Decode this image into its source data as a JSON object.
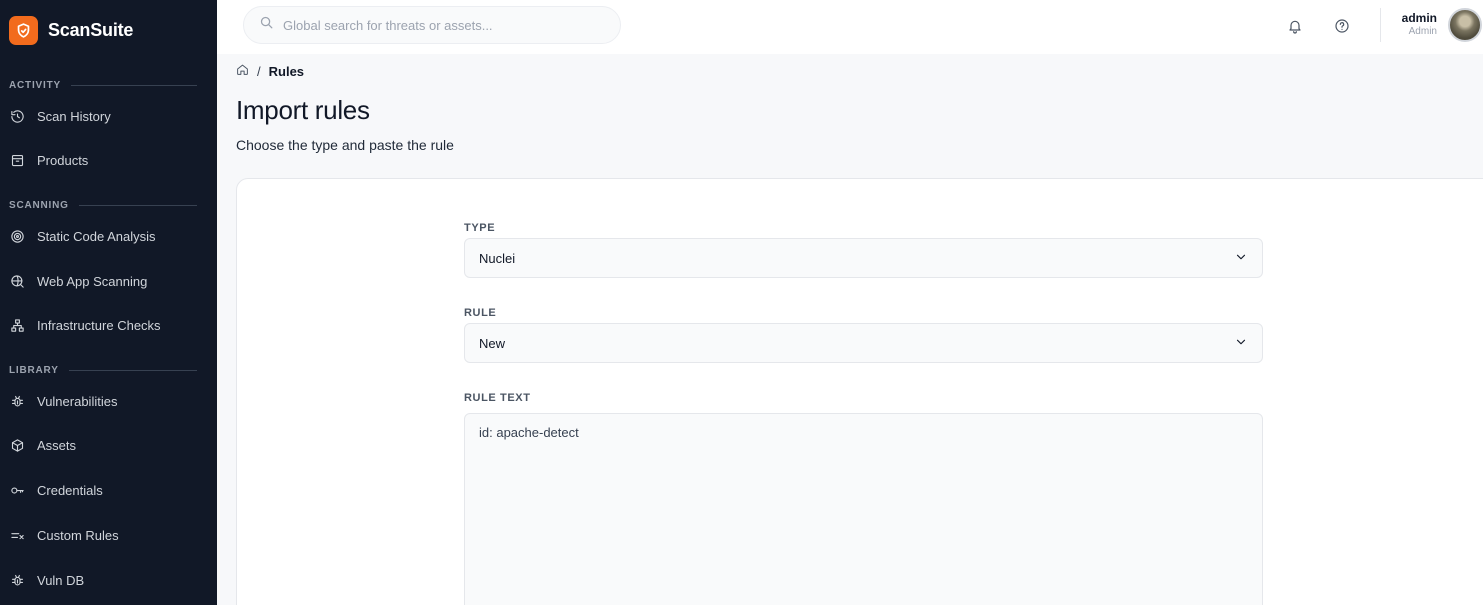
{
  "app": {
    "brand": "ScanSuite",
    "accent_color": "#f26b1d",
    "sidebar_bg": "#111827"
  },
  "sidebar": {
    "sections": [
      {
        "label": "ACTIVITY",
        "items": [
          {
            "label": "Scan History",
            "icon": "history-icon"
          },
          {
            "label": "Products",
            "icon": "archive-icon"
          }
        ]
      },
      {
        "label": "SCANNING",
        "items": [
          {
            "label": "Static Code Analysis",
            "icon": "target-icon"
          },
          {
            "label": "Web App Scanning",
            "icon": "globe-search-icon"
          },
          {
            "label": "Infrastructure Checks",
            "icon": "network-icon"
          }
        ]
      },
      {
        "label": "LIBRARY",
        "items": [
          {
            "label": "Vulnerabilities",
            "icon": "bug-icon"
          },
          {
            "label": "Assets",
            "icon": "cube-icon"
          },
          {
            "label": "Credentials",
            "icon": "key-icon"
          },
          {
            "label": "Custom Rules",
            "icon": "list-check-icon"
          },
          {
            "label": "Vuln DB",
            "icon": "bug-icon"
          }
        ]
      }
    ]
  },
  "topbar": {
    "search_placeholder": "Global search for threats or assets...",
    "user_name": "admin",
    "user_role": "Admin"
  },
  "breadcrumb": {
    "current": "Rules"
  },
  "page": {
    "title": "Import rules",
    "subtitle": "Choose the type and paste the rule"
  },
  "form": {
    "type_label": "TYPE",
    "type_value": "Nuclei",
    "rule_label": "RULE",
    "rule_value": "New",
    "rule_text_label": "RULE TEXT",
    "rule_text_value": "id: apache-detect"
  }
}
